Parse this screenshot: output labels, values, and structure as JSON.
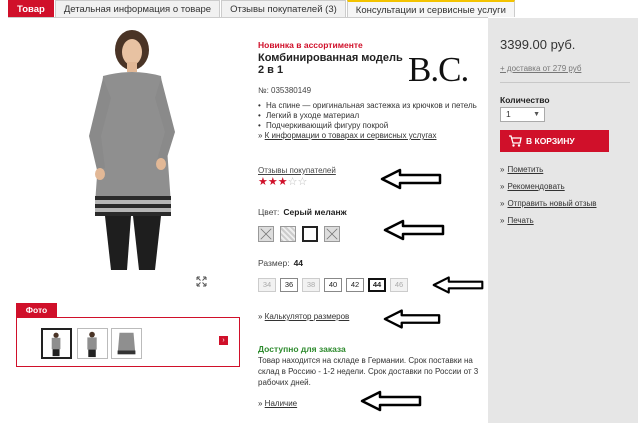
{
  "tabs": [
    {
      "label": "Товар"
    },
    {
      "label": "Детальная информация о товаре"
    },
    {
      "label": "Отзывы покупателей (3)"
    },
    {
      "label": "Консультации и сервисные услуги"
    }
  ],
  "product": {
    "new_label": "Новинка в ассортименте",
    "title": "Комбинированная модель 2 в 1",
    "brand": "B.C.",
    "article": "№: 035380149",
    "features": [
      "На спине — оригинальная застежка из крючков и петель",
      "Легкий в уходе материал",
      "Подчеркивающий фигуру покрой"
    ],
    "info_link": "К информации о товарах и сервисных услугах"
  },
  "reviews": {
    "link": "Отзывы покупателей",
    "rating": 3,
    "max": 5
  },
  "color": {
    "label": "Цвет:",
    "value": "Серый меланж",
    "swatches": [
      "unavailable",
      "pattern",
      "selected",
      "unavailable"
    ]
  },
  "size": {
    "label": "Размер:",
    "value": "44",
    "options": [
      {
        "v": "34",
        "state": "na"
      },
      {
        "v": "36",
        "state": "ok"
      },
      {
        "v": "38",
        "state": "na"
      },
      {
        "v": "40",
        "state": "ok"
      },
      {
        "v": "42",
        "state": "ok"
      },
      {
        "v": "44",
        "state": "sel"
      },
      {
        "v": "46",
        "state": "na"
      }
    ],
    "calc_link": "Калькулятор размеров"
  },
  "availability": {
    "title": "Доступно для заказа",
    "text": "Товар находится на складе в Германии. Срок поставки на склад в Россию - 1-2 недели. Срок доставки по России от 3 рабочих дней.",
    "stock_link": "Наличие"
  },
  "sidebar": {
    "price": "3399.00 руб.",
    "delivery": "+ доставка от 279 руб",
    "qty_label": "Количество",
    "qty_value": "1",
    "cart_button": "В КОРЗИНУ",
    "links": [
      "Пометить",
      "Рекомендовать",
      "Отправить новый отзыв",
      "Печать"
    ]
  },
  "photo": {
    "tab": "Фото"
  },
  "colors": {
    "accent": "#d0102a",
    "sidebar_bg": "#e6e6e6",
    "available_green": "#2e8b2e"
  }
}
